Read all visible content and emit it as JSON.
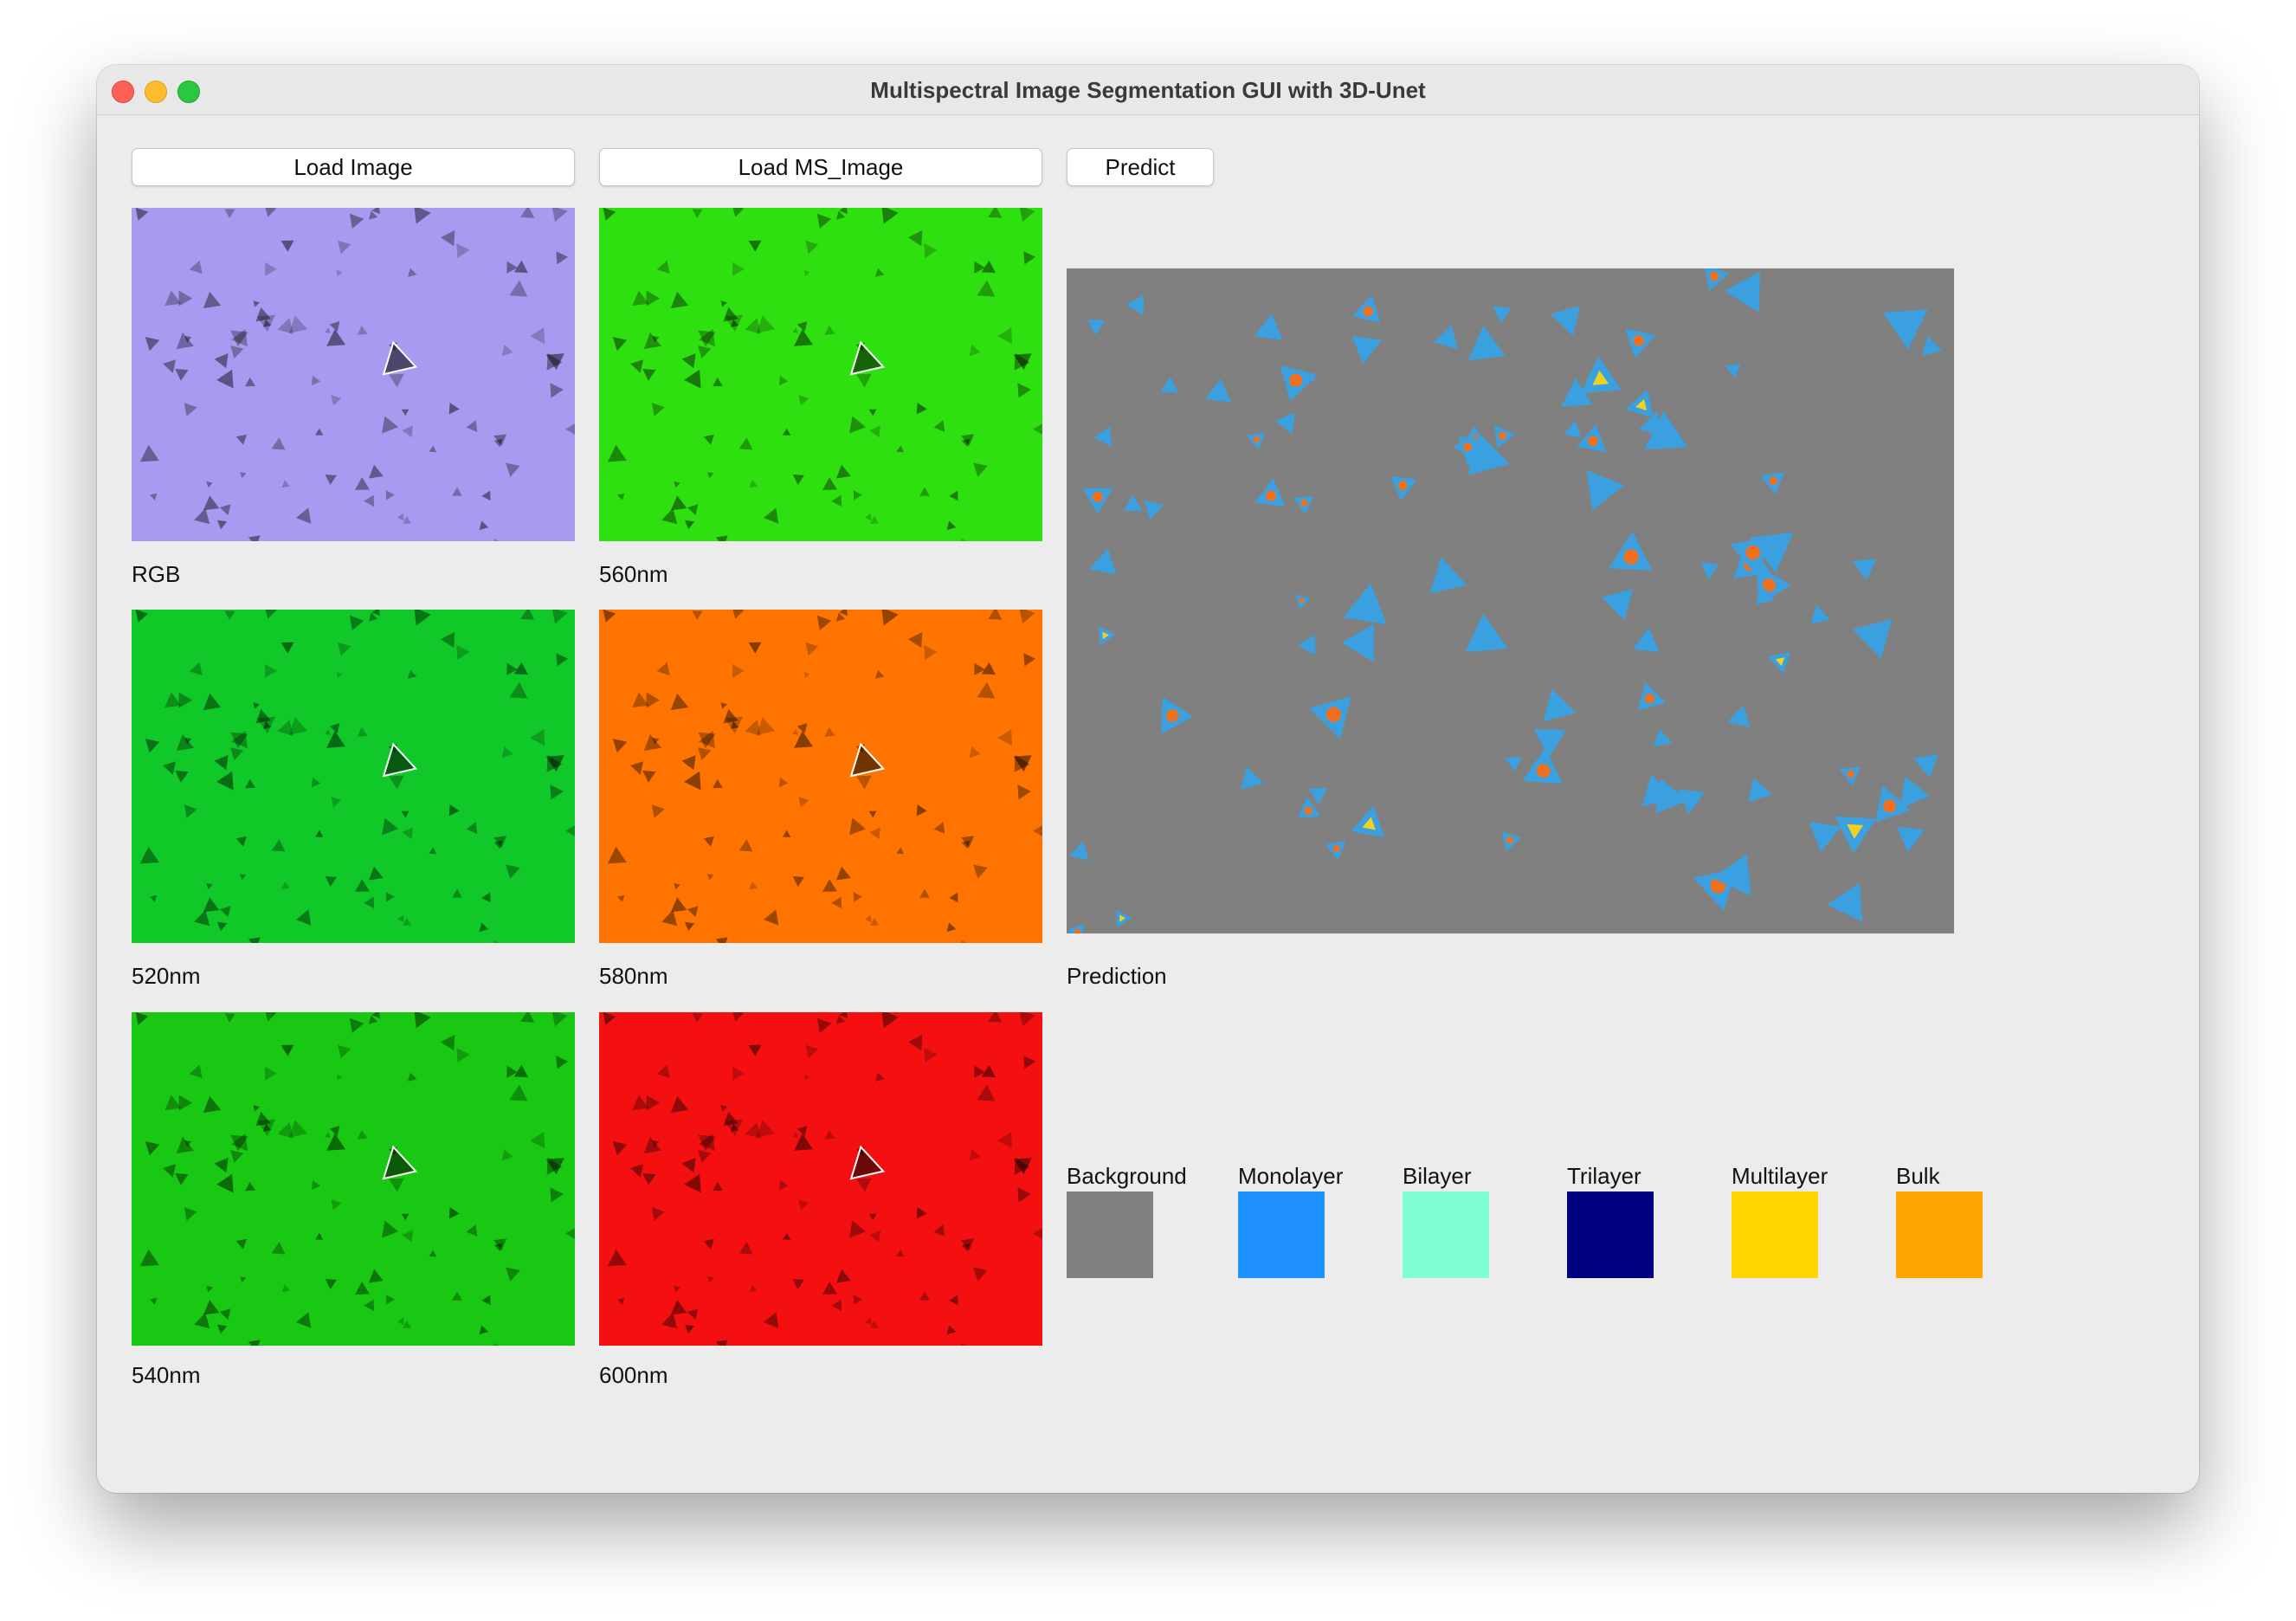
{
  "window": {
    "title": "Multispectral Image Segmentation GUI with 3D-Unet"
  },
  "toolbar": {
    "load_image_label": "Load Image",
    "load_ms_image_label": "Load MS_Image",
    "predict_label": "Predict"
  },
  "panels": [
    {
      "caption": "RGB",
      "color": "#a89af0"
    },
    {
      "caption": "560nm",
      "color": "#2fe010"
    },
    {
      "caption": "520nm",
      "color": "#10c828"
    },
    {
      "caption": "580nm",
      "color": "#ff7400"
    },
    {
      "caption": "540nm",
      "color": "#18c812"
    },
    {
      "caption": "600nm",
      "color": "#f41010"
    }
  ],
  "prediction": {
    "caption": "Prediction",
    "background_color": "#808080"
  },
  "legend": [
    {
      "label": "Background",
      "color": "#808080"
    },
    {
      "label": "Monolayer",
      "color": "#1e90ff"
    },
    {
      "label": "Bilayer",
      "color": "#7fffd4"
    },
    {
      "label": "Trilayer",
      "color": "#000080"
    },
    {
      "label": "Multilayer",
      "color": "#ffd700"
    },
    {
      "label": "Bulk",
      "color": "#ffa500"
    }
  ]
}
